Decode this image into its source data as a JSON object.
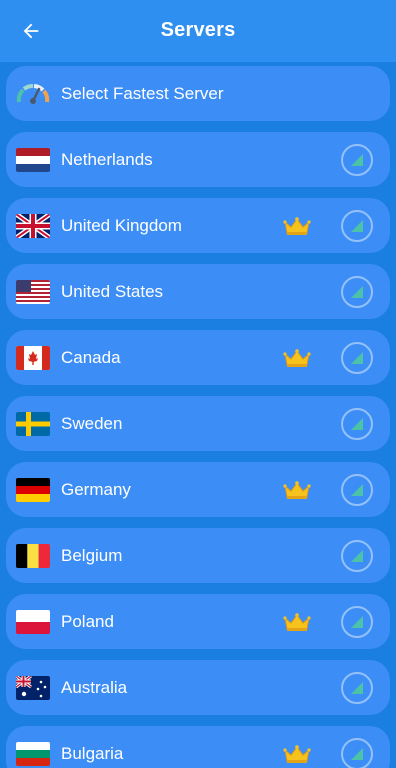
{
  "header": {
    "title": "Servers",
    "back_icon": "arrow-left-icon"
  },
  "fastest": {
    "label": "Select Fastest Server",
    "icon": "speedometer-icon"
  },
  "servers": [
    {
      "name": "Netherlands",
      "flag": "netherlands-flag-icon",
      "premium": false
    },
    {
      "name": "United Kingdom",
      "flag": "united-kingdom-flag-icon",
      "premium": true
    },
    {
      "name": "United States",
      "flag": "united-states-flag-icon",
      "premium": false
    },
    {
      "name": "Canada",
      "flag": "canada-flag-icon",
      "premium": true
    },
    {
      "name": "Sweden",
      "flag": "sweden-flag-icon",
      "premium": false
    },
    {
      "name": "Germany",
      "flag": "germany-flag-icon",
      "premium": true
    },
    {
      "name": "Belgium",
      "flag": "belgium-flag-icon",
      "premium": false
    },
    {
      "name": "Poland",
      "flag": "poland-flag-icon",
      "premium": true
    },
    {
      "name": "Australia",
      "flag": "australia-flag-icon",
      "premium": false
    },
    {
      "name": "Bulgaria",
      "flag": "bulgaria-flag-icon",
      "premium": true
    }
  ],
  "colors": {
    "background": "#1a7fe0",
    "appbar": "#2f8ff0",
    "row": "#3c8ef6",
    "crown": "#f6c21c",
    "signal": "#4cc3a8"
  }
}
